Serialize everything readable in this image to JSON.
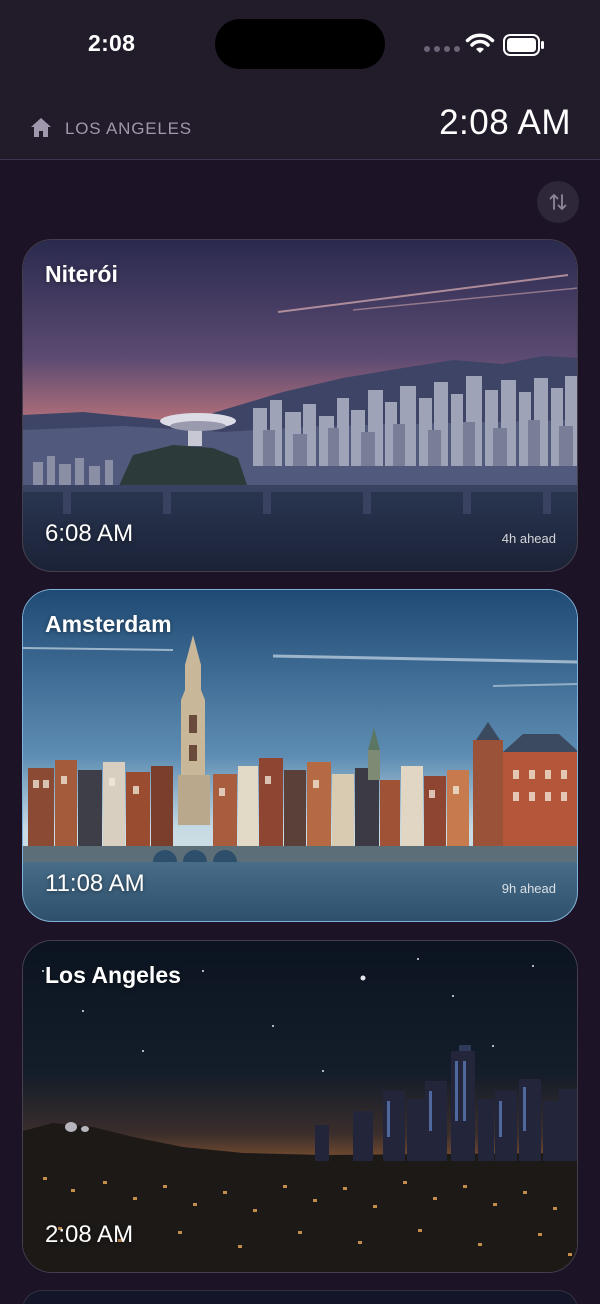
{
  "status_bar": {
    "time": "2:08"
  },
  "header": {
    "home_label": "LOS ANGELES",
    "current_time": "2:08 AM",
    "icons": [
      "house-icon",
      "sort-arrows-icon"
    ]
  },
  "cities": [
    {
      "name": "Niterói",
      "time": "6:08 AM",
      "offset": "4h ahead",
      "selected": false
    },
    {
      "name": "Amsterdam",
      "time": "11:08 AM",
      "offset": "9h ahead",
      "selected": true
    },
    {
      "name": "Los Angeles",
      "time": "2:08 AM",
      "offset": "",
      "selected": false
    }
  ],
  "colors": {
    "background": "#1c1426",
    "header": "#221b2a",
    "selected_border": "#7fb2da"
  }
}
